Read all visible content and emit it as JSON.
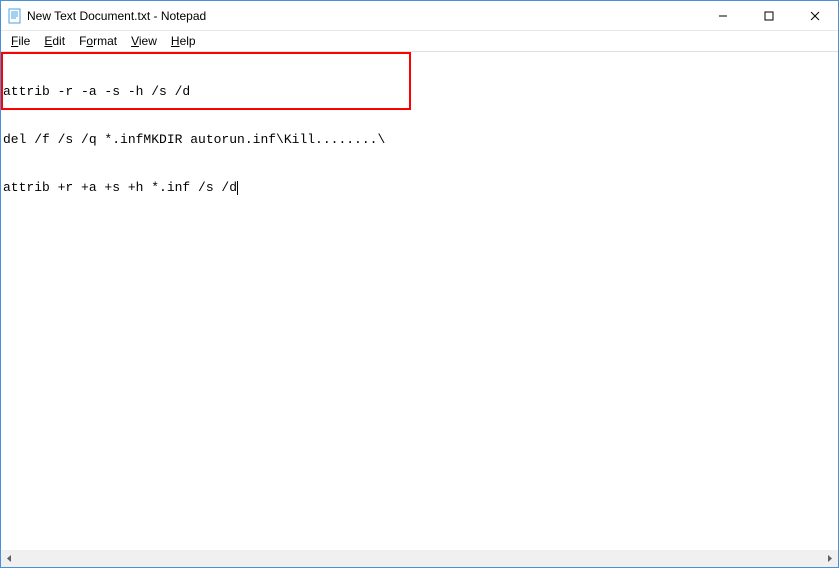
{
  "titlebar": {
    "title": "New Text Document.txt - Notepad"
  },
  "window_controls": {
    "minimize": "minimize",
    "maximize": "maximize",
    "close": "close"
  },
  "menubar": {
    "file_prefix": "F",
    "file_rest": "ile",
    "edit_prefix": "E",
    "edit_rest": "dit",
    "format_prefix": "o",
    "format_before": "F",
    "format_after": "rmat",
    "view_prefix": "V",
    "view_rest": "iew",
    "help_prefix": "H",
    "help_rest": "elp"
  },
  "editor": {
    "lines": [
      "attrib -r -a -s -h /s /d",
      "del /f /s /q *.infMKDIR autorun.inf\\Kill........\\",
      "attrib +r +a +s +h *.inf /s /d"
    ]
  },
  "scrollbar": {
    "left_arrow": "◀",
    "right_arrow": "▶"
  },
  "highlight": {
    "present": true
  }
}
